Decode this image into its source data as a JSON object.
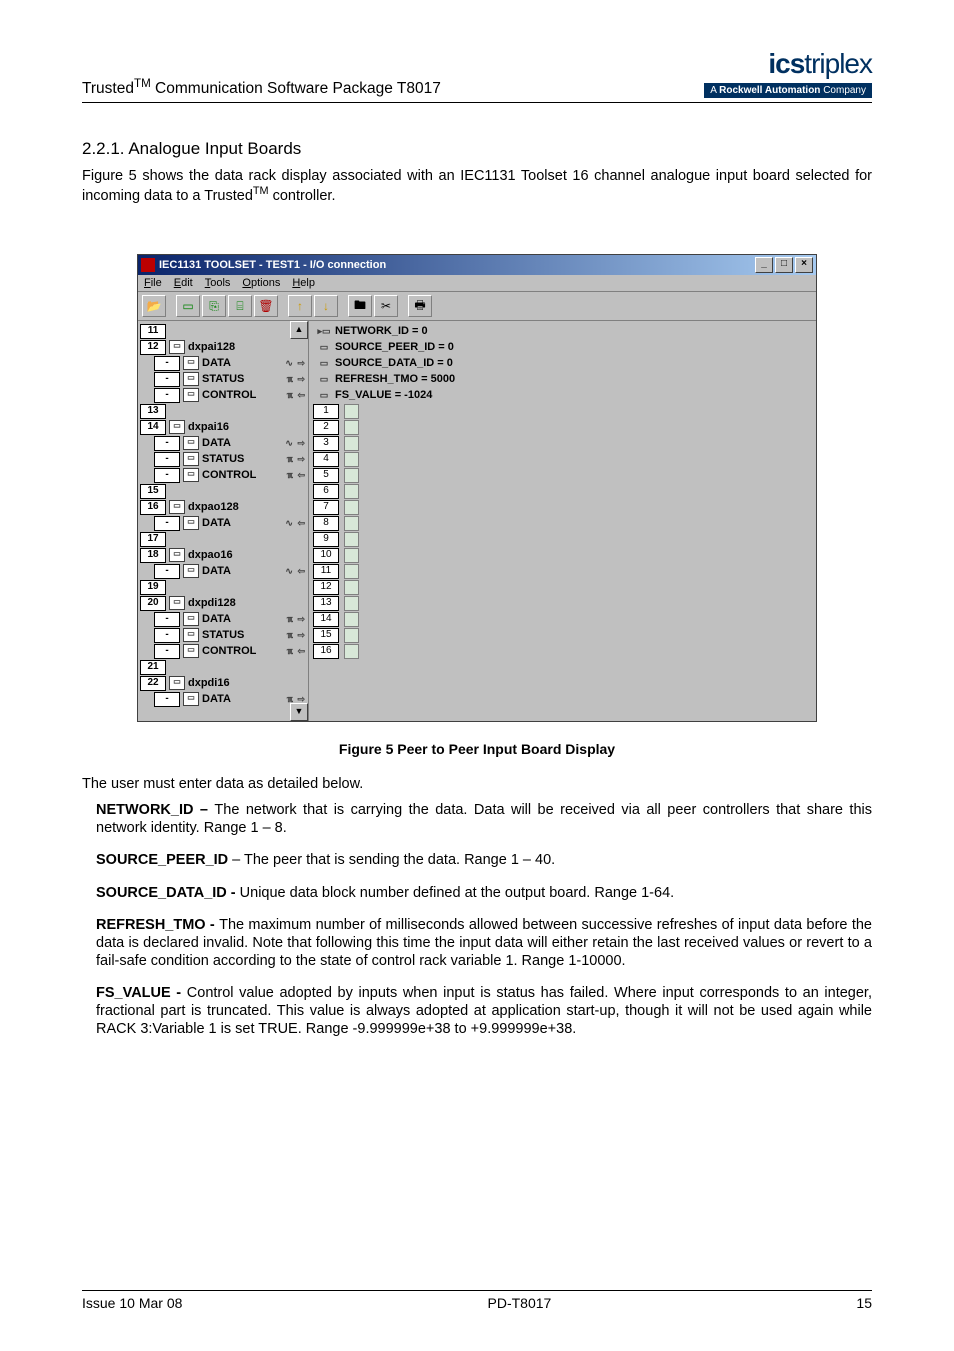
{
  "header": {
    "title_a": "Trusted",
    "title_b": " Communication Software Package T8017",
    "logo_brand": "ics",
    "logo_brand2": "triplex",
    "logo_sub_a": "A ",
    "logo_sub_b": "Rockwell Automation",
    "logo_sub_c": " Company"
  },
  "section": {
    "num": "2.2.1.  Analogue Input Boards",
    "intro_a": "Figure 5 shows the data rack display associated with an IEC1131 Toolset 16 channel analogue input board selected for incoming data to a Trusted",
    "intro_b": " controller."
  },
  "window": {
    "title": "IEC1131 TOOLSET - TEST1 - I/O connection",
    "menus": [
      "File",
      "Edit",
      "Tools",
      "Options",
      "Help"
    ]
  },
  "tree": [
    {
      "lvl": 0,
      "slot": "11",
      "icon": "",
      "label": "",
      "r": ""
    },
    {
      "lvl": 0,
      "slot": "12",
      "icon": "▭",
      "label": "dxpai128",
      "r": ""
    },
    {
      "lvl": 1,
      "slot": "-",
      "icon": "▭",
      "label": "DATA",
      "r": "∿ ⇨"
    },
    {
      "lvl": 1,
      "slot": "-",
      "icon": "▭",
      "label": "STATUS",
      "r": "ℼ ⇨"
    },
    {
      "lvl": 1,
      "slot": "-",
      "icon": "▭",
      "label": "CONTROL",
      "r": "ℼ ⇦"
    },
    {
      "lvl": 0,
      "slot": "13",
      "icon": "",
      "label": "",
      "r": ""
    },
    {
      "lvl": 0,
      "slot": "14",
      "icon": "▭",
      "label": "dxpai16",
      "r": ""
    },
    {
      "lvl": 1,
      "slot": "-",
      "icon": "▭",
      "label": "DATA",
      "r": "∿ ⇨"
    },
    {
      "lvl": 1,
      "slot": "-",
      "icon": "▭",
      "label": "STATUS",
      "r": "ℼ ⇨"
    },
    {
      "lvl": 1,
      "slot": "-",
      "icon": "▭",
      "label": "CONTROL",
      "r": "ℼ ⇦"
    },
    {
      "lvl": 0,
      "slot": "15",
      "icon": "",
      "label": "",
      "r": ""
    },
    {
      "lvl": 0,
      "slot": "16",
      "icon": "▭",
      "label": "dxpao128",
      "r": ""
    },
    {
      "lvl": 1,
      "slot": "-",
      "icon": "▭",
      "label": "DATA",
      "r": "∿ ⇦"
    },
    {
      "lvl": 0,
      "slot": "17",
      "icon": "",
      "label": "",
      "r": ""
    },
    {
      "lvl": 0,
      "slot": "18",
      "icon": "▭",
      "label": "dxpao16",
      "r": ""
    },
    {
      "lvl": 1,
      "slot": "-",
      "icon": "▭",
      "label": "DATA",
      "r": "∿ ⇦"
    },
    {
      "lvl": 0,
      "slot": "19",
      "icon": "",
      "label": "",
      "r": ""
    },
    {
      "lvl": 0,
      "slot": "20",
      "icon": "▭",
      "label": "dxpdi128",
      "r": ""
    },
    {
      "lvl": 1,
      "slot": "-",
      "icon": "▭",
      "label": "DATA",
      "r": "ℼ ⇨"
    },
    {
      "lvl": 1,
      "slot": "-",
      "icon": "▭",
      "label": "STATUS",
      "r": "ℼ ⇨"
    },
    {
      "lvl": 1,
      "slot": "-",
      "icon": "▭",
      "label": "CONTROL",
      "r": "ℼ ⇦"
    },
    {
      "lvl": 0,
      "slot": "21",
      "icon": "",
      "label": "",
      "r": ""
    },
    {
      "lvl": 0,
      "slot": "22",
      "icon": "▭",
      "label": "dxpdi16",
      "r": ""
    },
    {
      "lvl": 1,
      "slot": "-",
      "icon": "▭",
      "label": "DATA",
      "r": "ℼ ⇨"
    }
  ],
  "params": [
    {
      "icon": "▸▭",
      "text": "NETWORK_ID = 0"
    },
    {
      "icon": "▭",
      "text": "SOURCE_PEER_ID = 0"
    },
    {
      "icon": "▭",
      "text": "SOURCE_DATA_ID = 0"
    },
    {
      "icon": "▭",
      "text": "REFRESH_TMO = 5000"
    },
    {
      "icon": "▭",
      "text": "FS_VALUE = -1024"
    }
  ],
  "channels": [
    "1",
    "2",
    "3",
    "4",
    "5",
    "6",
    "7",
    "8",
    "9",
    "10",
    "11",
    "12",
    "13",
    "14",
    "15",
    "16"
  ],
  "caption": "Figure 5 Peer to Peer Input Board Display",
  "after_fig": "The user must enter data as detailed below.",
  "defs": [
    {
      "k": "NETWORK_ID – ",
      "v": "The network that is carrying the data.  Data will be received via all peer controllers that share this network identity. Range 1 – 8."
    },
    {
      "k": "SOURCE_PEER_ID",
      "v": " – The peer that is sending the data. Range 1 – 40."
    },
    {
      "k": "SOURCE_DATA_ID - ",
      "v": "Unique data block number defined at the output board. Range 1-64."
    },
    {
      "k": "REFRESH_TMO - ",
      "v": "The maximum number of milliseconds allowed between successive refreshes of input data before the data is declared invalid.  Note that following this time the input data will either retain the last received values or revert to a fail-safe condition according to the state of control rack variable 1. Range 1-10000."
    },
    {
      "k": "FS_VALUE  -  ",
      "v": "Control value adopted by inputs when input is status has failed. Where input corresponds to an integer, fractional part is truncated.  This value is always adopted at application start-up, though it will not be used again while RACK 3:Variable 1 is set TRUE. Range -9.999999e+38  to +9.999999e+38."
    }
  ],
  "footer": {
    "left": "Issue 10 Mar 08",
    "center": "PD-T8017",
    "right": "15"
  }
}
